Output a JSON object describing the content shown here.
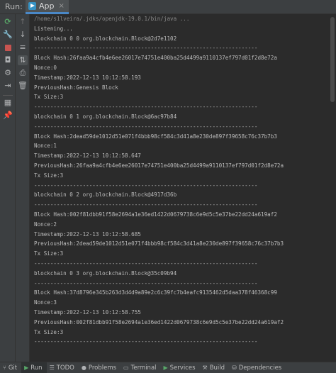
{
  "header": {
    "run_label": "Run:",
    "tab_name": "App",
    "tab_close": "×"
  },
  "toolbar": {
    "rerun": "⟳",
    "up": "↑",
    "down": "↓",
    "wrap": "≡",
    "sort": "⇅",
    "print": "⎙",
    "trash": "🗑",
    "wrench": "🔧",
    "camera": "◘",
    "gear": "⚙",
    "exit": "⇥",
    "layout": "▦",
    "pin": "📌"
  },
  "console": {
    "lines": [
      "/home/s1lveira/.jdks/openjdk-19.0.1/bin/java ...",
      "Listening...",
      "blockchain 0 0 org.blockchain.Block@2d7e1102",
      "---------------------------------------------------------------------",
      "Block Hash:26faa9a4cfb4e6ee26017e74751e400ba25d4499a9110137ef797d01f2d8e72a",
      "Nonce:0",
      "Timestamp:2022-12-13 10:12:58.193",
      "PreviousHash:Genesis Block",
      "Tx Size:3",
      "---------------------------------------------------------------------",
      "blockchain 0 1 org.blockchain.Block@6ac97b84",
      "---------------------------------------------------------------------",
      "Block Hash:2dead59de1012d51e071f4bbb98cf584c3d41a8e230de897f39658c76c37b7b3",
      "Nonce:1",
      "Timestamp:2022-12-13 10:12:58.647",
      "PreviousHash:26faa9a4cfb4e6ee26017e74751e400ba25d4499a9110137ef797d01f2d8e72a",
      "Tx Size:3",
      "---------------------------------------------------------------------",
      "blockchain 0 2 org.blockchain.Block@4917d36b",
      "---------------------------------------------------------------------",
      "Block Hash:002f81dbb91f58e2694a1e36ed1422d0679738c6e9d5c5e37be22dd24a619af2",
      "Nonce:2",
      "Timestamp:2022-12-13 10:12:58.685",
      "PreviousHash:2dead59de1012d51e071f4bbb98cf584c3d41a8e230de897f39658c76c37b7b3",
      "Tx Size:3",
      "---------------------------------------------------------------------",
      "blockchain 0 3 org.blockchain.Block@35c09b94",
      "---------------------------------------------------------------------",
      "Block Hash:37d8796e345b263d3d4d9a89e2c6c39fc7b4eafc9135462d5daa378f46368c99",
      "Nonce:3",
      "Timestamp:2022-12-13 10:12:58.755",
      "PreviousHash:002f81dbb91f58e2694a1e36ed1422d0679738c6e9d5c5e37be22dd24a619af2",
      "Tx Size:3",
      "---------------------------------------------------------------------"
    ]
  },
  "bottom_bar": {
    "tabs": [
      {
        "icon": "⑂",
        "label": "Git"
      },
      {
        "icon": "▶",
        "label": "Run"
      },
      {
        "icon": "☰",
        "label": "TODO"
      },
      {
        "icon": "●",
        "label": "Problems"
      },
      {
        "icon": "▭",
        "label": "Terminal"
      },
      {
        "icon": "▶",
        "label": "Services"
      },
      {
        "icon": "⚒",
        "label": "Build"
      },
      {
        "icon": "⛁",
        "label": "Dependencies"
      }
    ]
  },
  "colors": {
    "background": "#2b2b2b",
    "panel": "#3c3f41",
    "accent": "#4a88c7",
    "run_green": "#59a869",
    "stop_red": "#c75450"
  }
}
